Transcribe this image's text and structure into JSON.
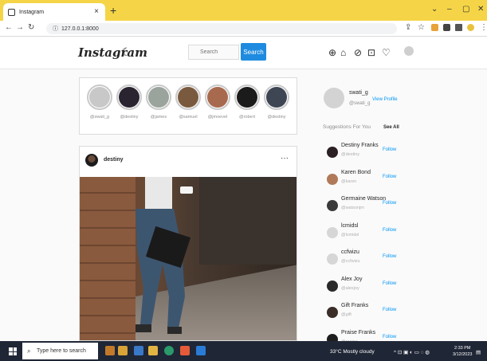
{
  "browser": {
    "tab_title": "Instagram",
    "tab_close": "×",
    "new_tab": "+",
    "url": "127.0.0.1:8000",
    "controls": {
      "minimize": "–",
      "maximize": "▢",
      "close": "✕",
      "collapse": "⌄"
    }
  },
  "header": {
    "logo": "Instagram",
    "search_placeholder": "Search",
    "search_button": "Search"
  },
  "stories": [
    {
      "username": "@swati_g",
      "color": "#c8c8c8"
    },
    {
      "username": "@destiny",
      "color": "#2a2330"
    },
    {
      "username": "@james",
      "color": "#9aa39c"
    },
    {
      "username": "@samuel",
      "color": "#7a5a3e"
    },
    {
      "username": "@jmoevel",
      "color": "#a86a4e"
    },
    {
      "username": "@robert",
      "color": "#1b1b1b"
    },
    {
      "username": "@destiny",
      "color": "#3e4654"
    }
  ],
  "post": {
    "username": "destiny",
    "more": "···"
  },
  "profile": {
    "name": "swati_g",
    "handle": "@swati_g",
    "view_profile": "View Profile"
  },
  "suggestions": {
    "title": "Suggestions For You",
    "see_all": "See All",
    "items": [
      {
        "name": "Destiny Franks",
        "handle": "@destiny",
        "follow": "Follow",
        "color": "#2b2024"
      },
      {
        "name": "Karen Bond",
        "handle": "@karen",
        "follow": "Follow",
        "color": "#b07a5a"
      },
      {
        "name": "Germaine Watson",
        "handle": "@watsonjm",
        "follow": "Follow",
        "color": "#3a3a3a"
      },
      {
        "name": "lcmidsl",
        "handle": "@lcmidsl",
        "follow": "Follow",
        "color": "#d6d6d6"
      },
      {
        "name": "ccfwizu",
        "handle": "@ccfwizu",
        "follow": "Follow",
        "color": "#d6d6d6"
      },
      {
        "name": "Alex Joy",
        "handle": "@alexjoy",
        "follow": "Follow",
        "color": "#2a2a2a"
      },
      {
        "name": "Gift Franks",
        "handle": "@gift",
        "follow": "Follow",
        "color": "#3b2e28"
      },
      {
        "name": "Praise Franks",
        "handle": "@praise",
        "follow": "Follow",
        "color": "#1e1e1e"
      }
    ]
  },
  "taskbar": {
    "search_placeholder": "Type here to search",
    "weather": "33°C  Mostly cloudy",
    "time": "2:33 PM",
    "date": "3/12/2023"
  }
}
